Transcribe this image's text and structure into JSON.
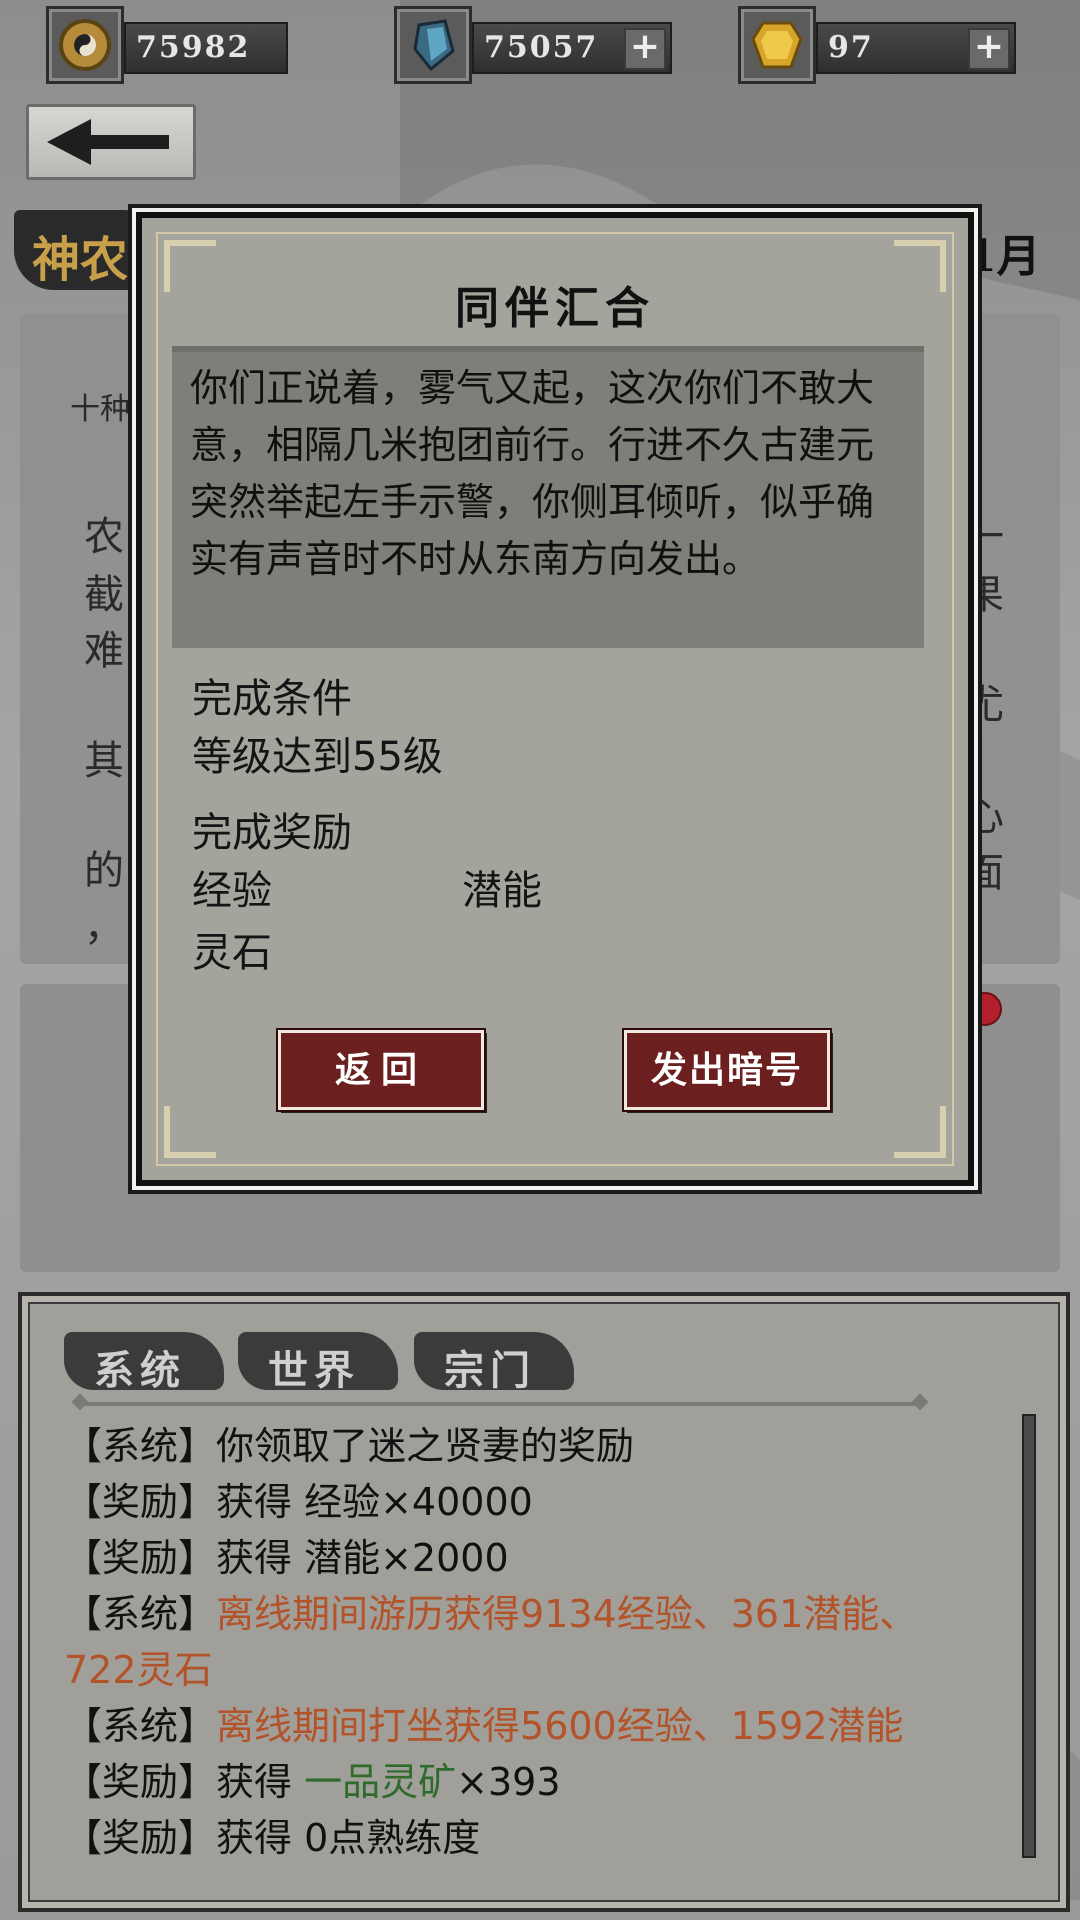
{
  "resources": [
    {
      "icon": "yin-yang-coin-icon",
      "value": "75982",
      "has_plus": false
    },
    {
      "icon": "blue-crystal-icon",
      "value": "75057",
      "has_plus": true
    },
    {
      "icon": "gold-gem-icon",
      "value": "97",
      "has_plus": true
    }
  ],
  "header": {
    "title_partial": "神农",
    "month": "1月"
  },
  "background_fragments": {
    "line1": "十种",
    "col_left": [
      "农",
      "截",
      "难",
      "其",
      "的",
      "，"
    ],
    "col_right": [
      "一",
      "果",
      "尤",
      "心",
      "面"
    ]
  },
  "modal": {
    "title": "同伴汇合",
    "story": "你们正说着，雾气又起，这次你们不敢大意，相隔几米抱团前行。行进不久古建元突然举起左手示警，你侧耳倾听，似乎确实有声音时不时从东南方向发出。",
    "condition_label": "完成条件",
    "condition_value": "等级达到55级",
    "reward_label": "完成奖励",
    "reward_exp": "经验",
    "reward_potential": "潜能",
    "reward_stone": "灵石",
    "back_button": "返回",
    "signal_button": "发出暗号"
  },
  "chat": {
    "tabs": [
      "系统",
      "世界",
      "宗门"
    ],
    "lines": [
      {
        "tag": "【系统】",
        "text": "你领取了迷之贤妻的奖励",
        "color": "normal"
      },
      {
        "tag": "【奖励】",
        "text": "获得 经验×40000",
        "color": "normal"
      },
      {
        "tag": "【奖励】",
        "text": "获得 潜能×2000",
        "color": "normal"
      },
      {
        "tag": "【系统】",
        "text": "离线期间游历获得9134经验、361潜能、722灵石",
        "color": "orange"
      },
      {
        "tag": "【系统】",
        "text": "离线期间打坐获得5600经验、1592潜能",
        "color": "orange"
      },
      {
        "tag": "【奖励】",
        "text_prefix": "获得 ",
        "text_green": "一品灵矿",
        "text_suffix": "×393"
      },
      {
        "tag": "【奖励】",
        "text": "获得 0点熟练度",
        "color": "normal"
      }
    ]
  },
  "colors": {
    "accent_red": "#6b1f1f",
    "orange_text": "#b3532a",
    "green_text": "#2f6b2c"
  }
}
